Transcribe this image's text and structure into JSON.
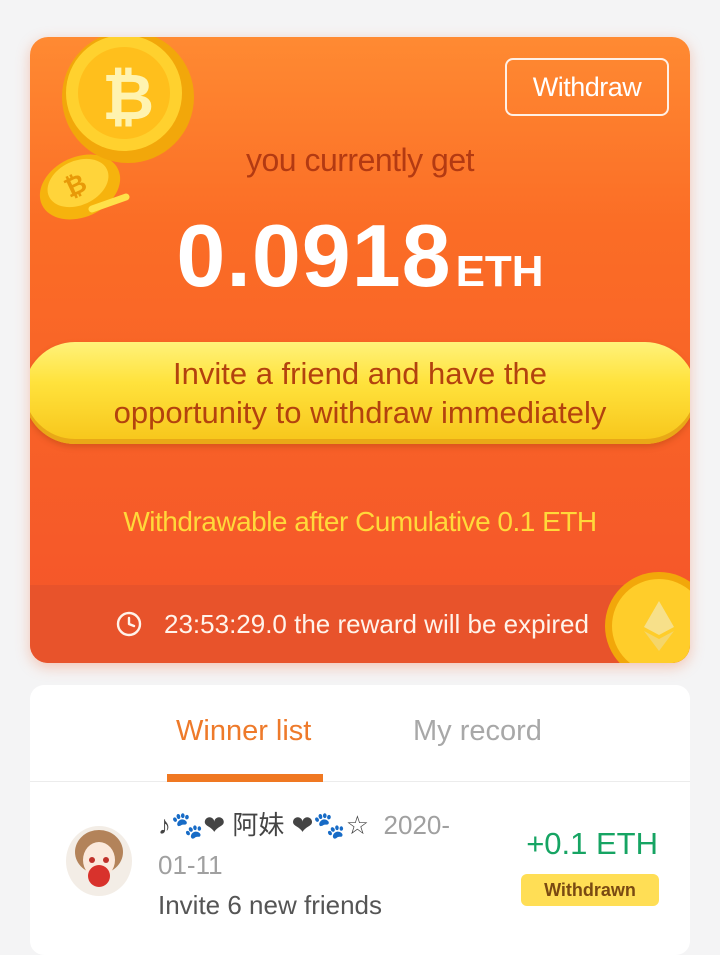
{
  "card": {
    "withdraw_label": "Withdraw",
    "get_label": "you currently get",
    "amount": "0.0918",
    "unit": "ETH",
    "invite_line1": "Invite a friend and have the",
    "invite_line2": "opportunity to withdraw immediately",
    "withdrawable_text": "Withdrawable after Cumulative 0.1 ETH",
    "expire_text": "23:53:29.0 the reward will be expired"
  },
  "tabs": [
    {
      "label": "Winner list",
      "active": true
    },
    {
      "label": "My record",
      "active": false
    }
  ],
  "winners": [
    {
      "name": "♪🐾❤ 阿妹 ❤🐾☆",
      "date": "2020-01-11",
      "date_line1": "2020-",
      "date_line2": "01-11",
      "description": "Invite 6 new friends",
      "reward": "+0.1 ETH",
      "status": "Withdrawn"
    }
  ],
  "colors": {
    "card_top": "#ff8a32",
    "card_bottom": "#f4532a",
    "accent_orange": "#f07822",
    "reward_green": "#16a463",
    "badge_yellow": "#ffde55"
  }
}
